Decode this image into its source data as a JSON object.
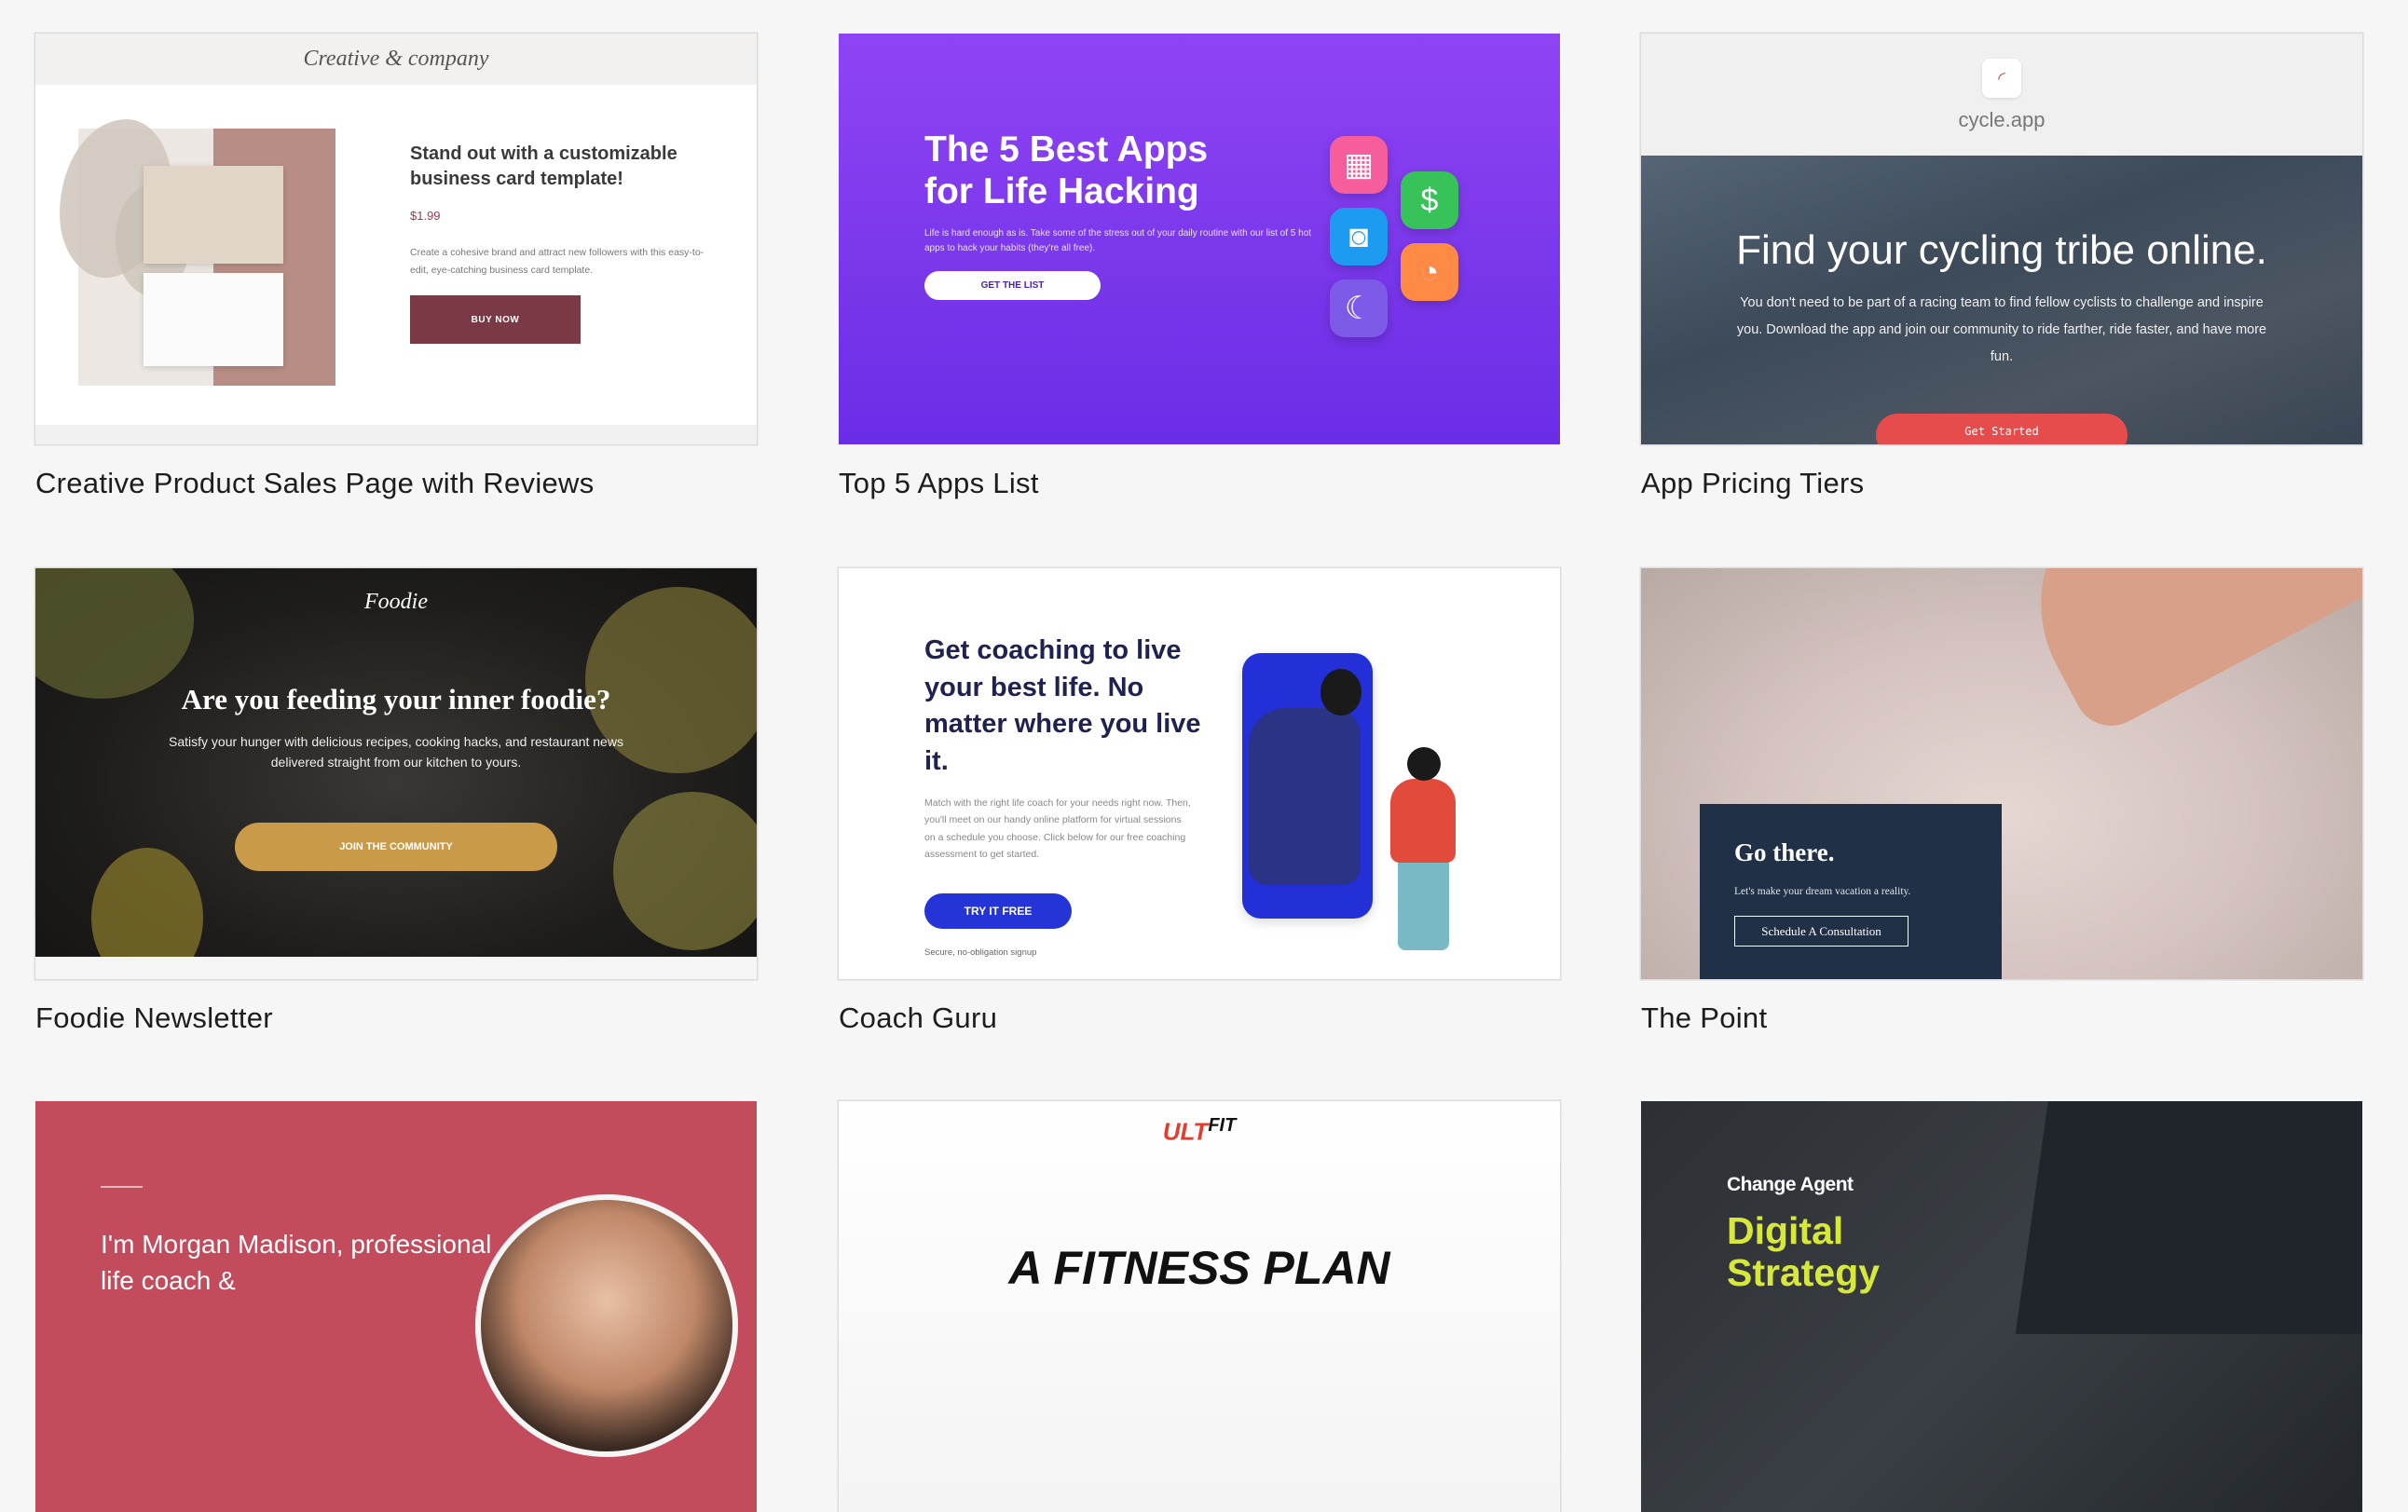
{
  "cards": [
    {
      "title": "Creative Product Sales Page with Reviews",
      "preview": {
        "logo": "Creative & company",
        "headline": "Stand out with a customizable business card template!",
        "price": "$1.99",
        "description": "Create a cohesive brand and attract new followers with this easy-to-edit, eye-catching business card template.",
        "button": "BUY NOW"
      }
    },
    {
      "title": "Top 5 Apps List",
      "preview": {
        "headline": "The 5 Best Apps for Life Hacking",
        "description": "Life is hard enough as is. Take some of the stress out of your daily routine with our list of 5 hot apps to hack your habits (they're all free).",
        "button": "GET THE LIST",
        "icons": [
          "calendar-icon",
          "dollar-icon",
          "watch-icon",
          "timer-icon",
          "moon-icon"
        ]
      }
    },
    {
      "title": "App Pricing Tiers",
      "preview": {
        "domain": "cycle.app",
        "headline": "Find your cycling tribe online.",
        "description": "You don't need to be part of a racing team to find fellow cyclists to challenge and inspire you. Download the app and join our community to ride farther, ride faster, and have more fun.",
        "button": "Get Started"
      }
    },
    {
      "title": "Foodie Newsletter",
      "preview": {
        "logo": "Foodie",
        "headline": "Are you feeding your inner foodie?",
        "description": "Satisfy your hunger with delicious recipes, cooking hacks, and restaurant news delivered straight from our kitchen to yours.",
        "button": "JOIN THE COMMUNITY"
      }
    },
    {
      "title": "Coach Guru",
      "preview": {
        "headline": "Get coaching to live your best life. No matter where you live it.",
        "description": "Match with the right life coach for your needs right now. Then, you'll meet on our handy online platform for virtual sessions on a schedule you choose. Click below for our free coaching assessment to get started.",
        "button": "TRY IT FREE",
        "fineprint": "Secure, no-obligation signup"
      }
    },
    {
      "title": "The Point",
      "preview": {
        "headline": "Go there.",
        "description": "Let's make your dream vacation a reality.",
        "button": "Schedule A Consultation"
      }
    },
    {
      "title": "",
      "preview": {
        "text": "I'm Morgan Madison, professional life coach &"
      }
    },
    {
      "title": "",
      "preview": {
        "logo_a": "ULT",
        "logo_b": "FIT",
        "headline": "A FITNESS PLAN"
      }
    },
    {
      "title": "",
      "preview": {
        "brand": "Change Agent",
        "headline": "Digital Strategy"
      }
    }
  ],
  "colors": {
    "page_bg": "#f6f6f6",
    "purple": "#8f44f3",
    "red_cta": "#e64c4c",
    "gold_cta": "#c99a48",
    "blue_cta": "#2434d6",
    "navy_panel": "#1f3047",
    "rose": "#c24b5c",
    "lime": "#d8e83a"
  }
}
